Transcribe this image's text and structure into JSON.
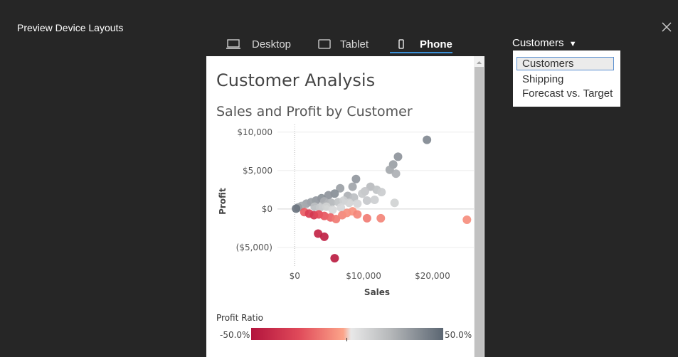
{
  "header": {
    "title": "Preview Device Layouts",
    "close_icon": "close-icon"
  },
  "device_tabs": [
    {
      "label": "Desktop",
      "icon": "desktop-icon",
      "active": false
    },
    {
      "label": "Tablet",
      "icon": "tablet-icon",
      "active": false
    },
    {
      "label": "Phone",
      "icon": "phone-icon",
      "active": true
    }
  ],
  "dashboard_selector": {
    "selected": "Customers",
    "options": [
      "Customers",
      "Shipping",
      "Forecast vs. Target"
    ]
  },
  "dashboard": {
    "title": "Customer Analysis",
    "legend": {
      "title": "Profit Ratio",
      "min_label": "-50.0%",
      "max_label": "50.0%"
    }
  },
  "chart_data": {
    "type": "scatter",
    "title": "Sales and Profit by Customer",
    "xlabel": "Sales",
    "ylabel": "Profit",
    "xlim": [
      -2500,
      26000
    ],
    "ylim": [
      -7500,
      11000
    ],
    "x_ticks": [
      {
        "value": 0,
        "label": "$0"
      },
      {
        "value": 10000,
        "label": "$10,000"
      },
      {
        "value": 20000,
        "label": "$20,000"
      }
    ],
    "y_ticks": [
      {
        "value": 10000,
        "label": "$10,000"
      },
      {
        "value": 5000,
        "label": "$5,000"
      },
      {
        "value": 0,
        "label": "$0"
      },
      {
        "value": -5000,
        "label": "($5,000)"
      }
    ],
    "color_scale": {
      "field": "Profit Ratio",
      "min": -0.5,
      "max": 0.5
    },
    "points": [
      {
        "x": 19200,
        "y": 9000,
        "r": 0.38
      },
      {
        "x": 15000,
        "y": 6800,
        "r": 0.34
      },
      {
        "x": 14300,
        "y": 5800,
        "r": 0.3
      },
      {
        "x": 13800,
        "y": 5100,
        "r": 0.27
      },
      {
        "x": 14700,
        "y": 4600,
        "r": 0.24
      },
      {
        "x": 8900,
        "y": 3900,
        "r": 0.33
      },
      {
        "x": 8400,
        "y": 2900,
        "r": 0.28
      },
      {
        "x": 6600,
        "y": 2700,
        "r": 0.3
      },
      {
        "x": 11000,
        "y": 2900,
        "r": 0.18
      },
      {
        "x": 11900,
        "y": 2500,
        "r": 0.14
      },
      {
        "x": 10200,
        "y": 2300,
        "r": 0.12
      },
      {
        "x": 9800,
        "y": 2000,
        "r": 0.1
      },
      {
        "x": 12600,
        "y": 2200,
        "r": 0.09
      },
      {
        "x": 5800,
        "y": 2000,
        "r": 0.36
      },
      {
        "x": 4900,
        "y": 1800,
        "r": 0.34
      },
      {
        "x": 7700,
        "y": 1700,
        "r": 0.24
      },
      {
        "x": 8600,
        "y": 1500,
        "r": 0.16
      },
      {
        "x": 10500,
        "y": 1100,
        "r": 0.11
      },
      {
        "x": 11600,
        "y": 1200,
        "r": 0.08
      },
      {
        "x": 14500,
        "y": 800,
        "r": 0.06
      },
      {
        "x": 3900,
        "y": 1400,
        "r": 0.35
      },
      {
        "x": 3100,
        "y": 1100,
        "r": 0.33
      },
      {
        "x": 2400,
        "y": 900,
        "r": 0.3
      },
      {
        "x": 1700,
        "y": 700,
        "r": 0.29
      },
      {
        "x": 1000,
        "y": 400,
        "r": 0.26
      },
      {
        "x": 500,
        "y": 200,
        "r": 0.3
      },
      {
        "x": 200,
        "y": 50,
        "r": 0.45
      },
      {
        "x": 4300,
        "y": 1000,
        "r": 0.25
      },
      {
        "x": 5300,
        "y": 800,
        "r": 0.2
      },
      {
        "x": 6300,
        "y": 900,
        "r": 0.14
      },
      {
        "x": 7100,
        "y": 1100,
        "r": 0.07
      },
      {
        "x": 7900,
        "y": 800,
        "r": 0.05
      },
      {
        "x": 9100,
        "y": 700,
        "r": 0.04
      },
      {
        "x": 2900,
        "y": 300,
        "r": 0.16
      },
      {
        "x": 3700,
        "y": 200,
        "r": 0.1
      },
      {
        "x": 4600,
        "y": 300,
        "r": 0.06
      },
      {
        "x": 5500,
        "y": -100,
        "r": 0.02
      },
      {
        "x": 6700,
        "y": 200,
        "r": 0.03
      },
      {
        "x": 1400,
        "y": -400,
        "r": -0.2
      },
      {
        "x": 2100,
        "y": -600,
        "r": -0.3
      },
      {
        "x": 2800,
        "y": -800,
        "r": -0.34
      },
      {
        "x": 3500,
        "y": -700,
        "r": -0.26
      },
      {
        "x": 4300,
        "y": -900,
        "r": -0.22
      },
      {
        "x": 5200,
        "y": -1100,
        "r": -0.18
      },
      {
        "x": 6000,
        "y": -1300,
        "r": -0.12
      },
      {
        "x": 6900,
        "y": -800,
        "r": -0.09
      },
      {
        "x": 7600,
        "y": -500,
        "r": -0.06
      },
      {
        "x": 8400,
        "y": -300,
        "r": -0.05
      },
      {
        "x": 9100,
        "y": -700,
        "r": -0.08
      },
      {
        "x": 10500,
        "y": -1200,
        "r": -0.11
      },
      {
        "x": 12500,
        "y": -1200,
        "r": -0.09
      },
      {
        "x": 3400,
        "y": -3200,
        "r": -0.42
      },
      {
        "x": 4300,
        "y": -3600,
        "r": -0.44
      },
      {
        "x": 5800,
        "y": -6400,
        "r": -0.46
      },
      {
        "x": 25000,
        "y": -1400,
        "r": -0.06
      }
    ]
  }
}
